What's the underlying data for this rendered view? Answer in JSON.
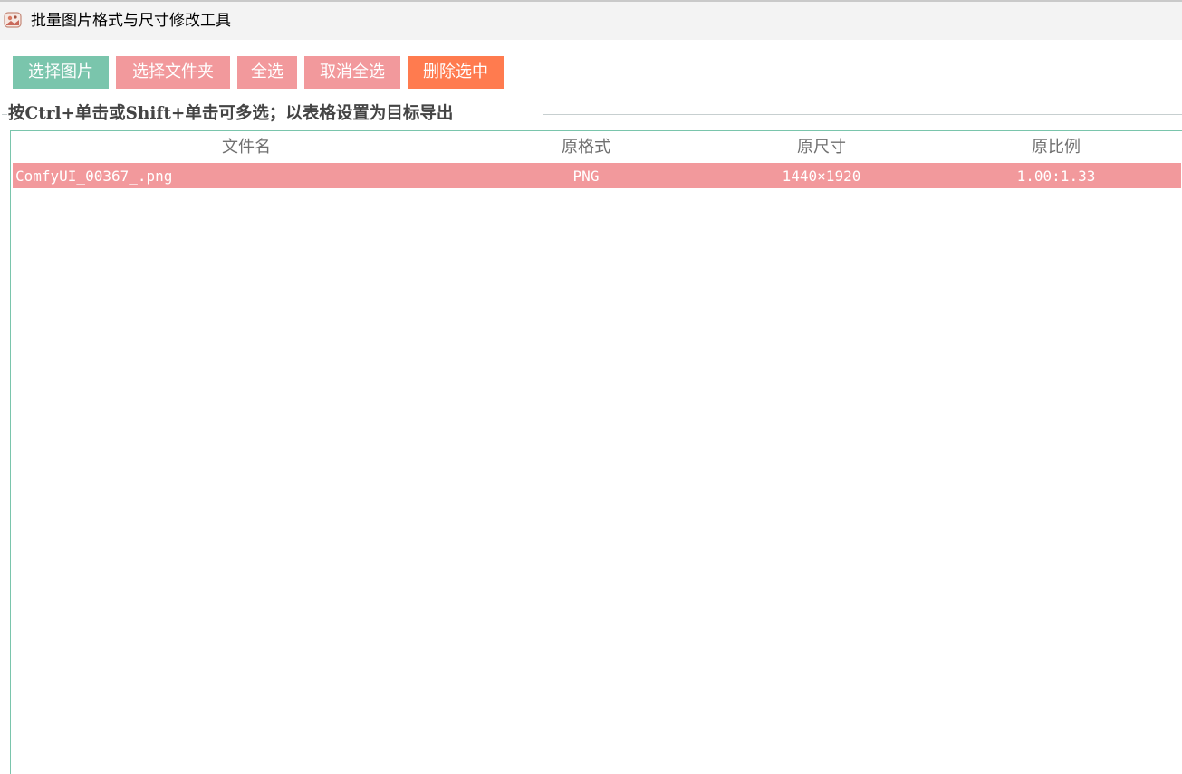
{
  "window": {
    "title": "批量图片格式与尺寸修改工具",
    "icon": "app-photo-icon"
  },
  "toolbar": {
    "select_images": "选择图片",
    "select_folder": "选择文件夹",
    "select_all": "全选",
    "deselect_all": "取消全选",
    "delete_selected": "删除选中"
  },
  "colors": {
    "green": "#7ac5ac",
    "pink": "#f2999c",
    "orange": "#ff7b4f"
  },
  "group": {
    "label": "按Ctrl+单击或Shift+单击可多选；以表格设置为目标导出"
  },
  "table": {
    "columns": [
      "文件名",
      "原格式",
      "原尺寸",
      "原比例"
    ],
    "rows": [
      {
        "name": "ComfyUI_00367_.png",
        "format": "PNG",
        "size": "1440×1920",
        "ratio": "1.00:1.33",
        "selected": true
      }
    ]
  }
}
